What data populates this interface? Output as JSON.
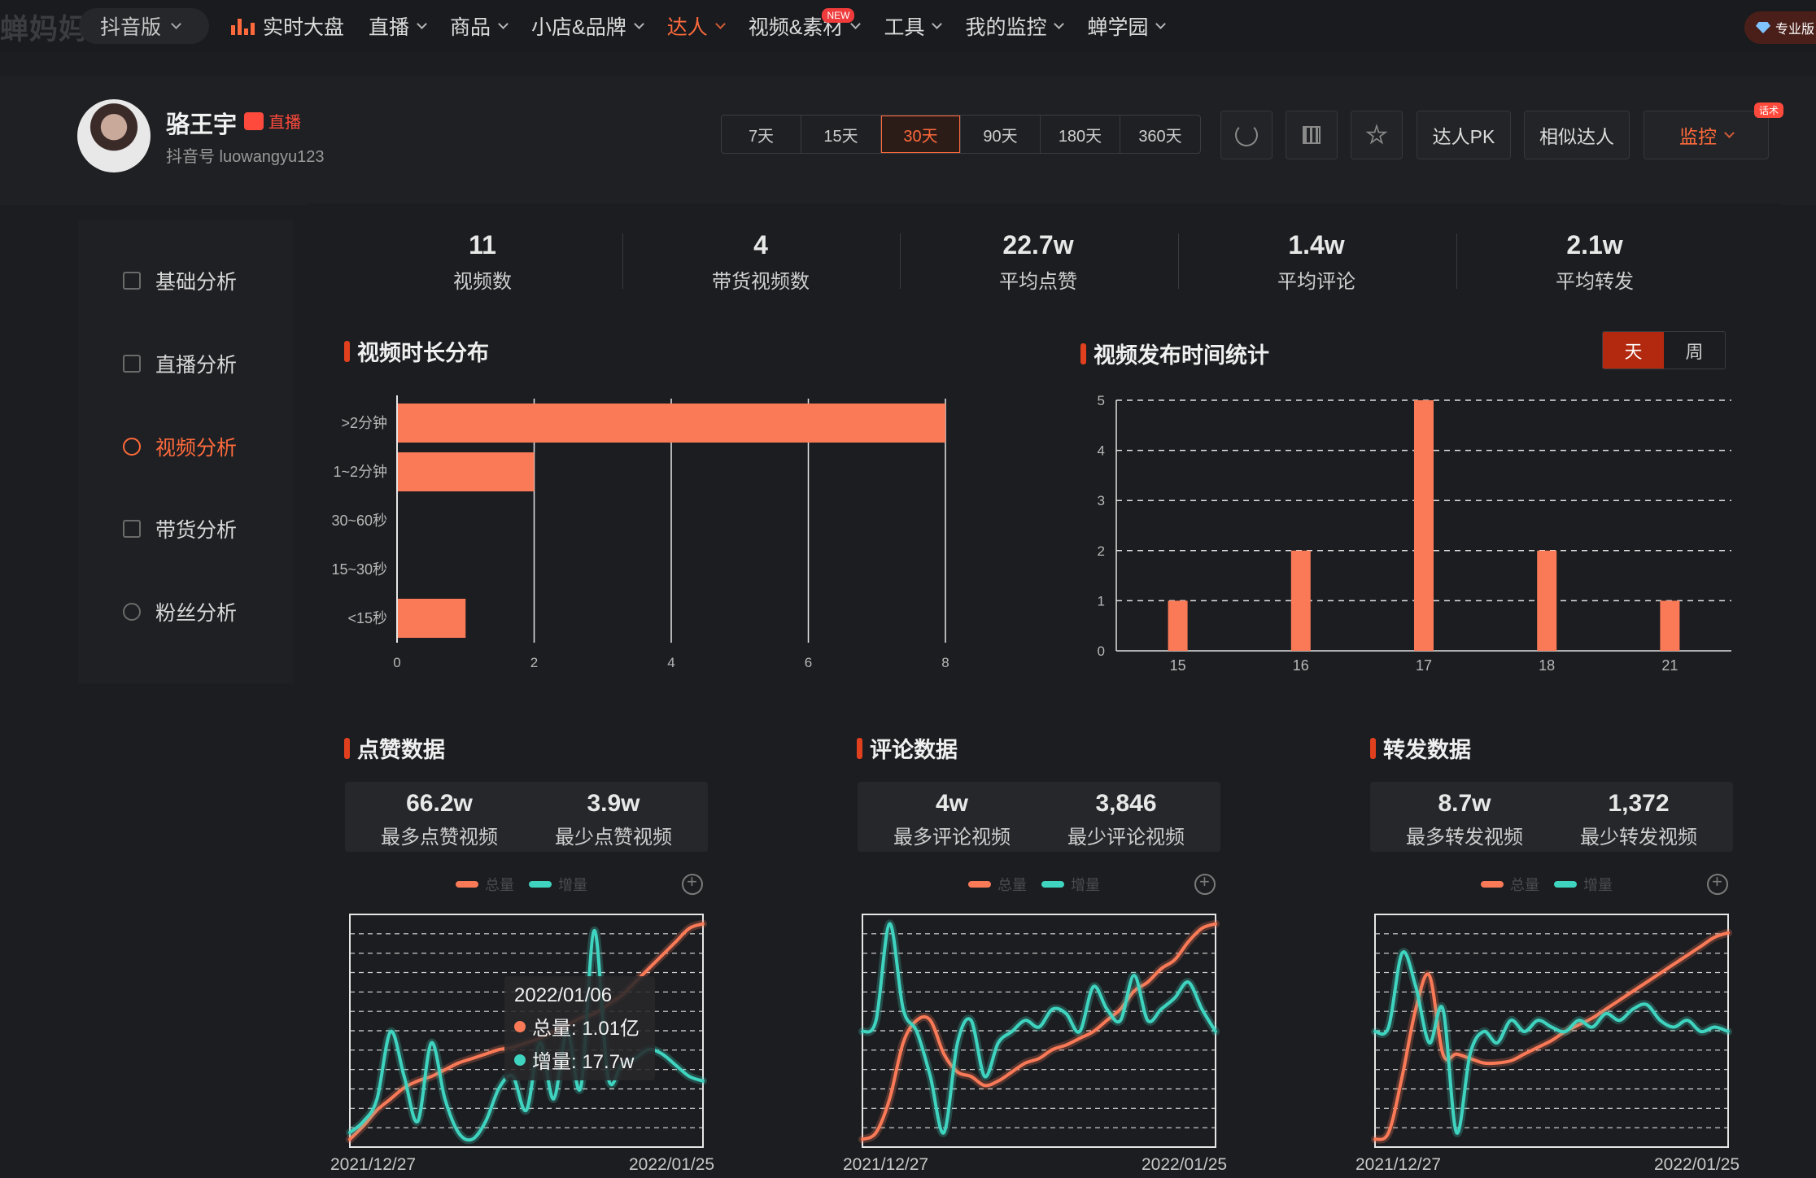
{
  "app": {
    "logo_text": "蝉妈妈",
    "version_label": "抖音版",
    "pro_label": "专业版"
  },
  "nav": {
    "items": [
      {
        "label": "实时大盘",
        "icon": "bar-chart-icon"
      },
      {
        "label": "直播"
      },
      {
        "label": "商品"
      },
      {
        "label": "小店&品牌"
      },
      {
        "label": "达人",
        "active": true
      },
      {
        "label": "视频&素材",
        "badge": "NEW"
      },
      {
        "label": "工具"
      },
      {
        "label": "我的监控"
      },
      {
        "label": "蝉学园"
      }
    ]
  },
  "profile": {
    "name": "骆王宇",
    "live_label": "直播",
    "douyin_id": "抖音号 luowangyu123"
  },
  "periods": [
    "7天",
    "15天",
    "30天",
    "90天",
    "180天",
    "360天"
  ],
  "active_period": "30天",
  "actions": {
    "pk": "达人PK",
    "similar": "相似达人",
    "monitor": "监控",
    "monitor_tag": "话术"
  },
  "sidebar": {
    "items": [
      {
        "label": "基础分析"
      },
      {
        "label": "直播分析"
      },
      {
        "label": "视频分析",
        "active": true
      },
      {
        "label": "带货分析"
      },
      {
        "label": "粉丝分析"
      }
    ]
  },
  "stats": [
    {
      "value": "11",
      "label": "视频数"
    },
    {
      "value": "4",
      "label": "带货视频数"
    },
    {
      "value": "22.7w",
      "label": "平均点赞"
    },
    {
      "value": "1.4w",
      "label": "平均评论"
    },
    {
      "value": "2.1w",
      "label": "平均转发"
    }
  ],
  "sections": {
    "duration": "视频时长分布",
    "publish": "视频发布时间统计",
    "publish_toggle": [
      "天",
      "周"
    ],
    "likes": "点赞数据",
    "comments": "评论数据",
    "shares": "转发数据"
  },
  "mini": {
    "likes": [
      {
        "value": "66.2w",
        "label": "最多点赞视频"
      },
      {
        "value": "3.9w",
        "label": "最少点赞视频"
      }
    ],
    "comments": [
      {
        "value": "4w",
        "label": "最多评论视频"
      },
      {
        "value": "3,846",
        "label": "最少评论视频"
      }
    ],
    "shares": [
      {
        "value": "8.7w",
        "label": "最多转发视频"
      },
      {
        "value": "1,372",
        "label": "最少转发视频"
      }
    ]
  },
  "legend": {
    "total": "总量",
    "increment": "增量"
  },
  "dates": {
    "start": "2021/12/27",
    "end": "2022/01/25"
  },
  "tooltip": {
    "date": "2022/01/06",
    "total": "总量: 1.01亿",
    "increment": "增量: 17.7w"
  },
  "colors": {
    "accent": "#fe6a3c",
    "bar": "#fa7a57",
    "teal": "#3fd4c0",
    "bg": "#1c1d20"
  },
  "chart_data": [
    {
      "type": "bar",
      "orientation": "horizontal",
      "categories": [
        ">2分钟",
        "1~2分钟",
        "30~60秒",
        "15~30秒",
        "<15秒"
      ],
      "values": [
        8,
        2,
        0,
        0,
        1
      ],
      "xlim": [
        0,
        8
      ],
      "xticks": [
        0,
        2,
        4,
        6,
        8
      ],
      "title": "视频时长分布"
    },
    {
      "type": "bar",
      "categories": [
        "15",
        "16",
        "17",
        "18",
        "21"
      ],
      "values": [
        1,
        2,
        5,
        2,
        1
      ],
      "ylim": [
        0,
        5
      ],
      "yticks": [
        0,
        1,
        2,
        3,
        4,
        5
      ],
      "title": "视频发布时间统计"
    },
    {
      "type": "line",
      "title": "点赞数据",
      "x_range": [
        "2021/12/27",
        "2022/01/25"
      ],
      "series": [
        {
          "name": "总量",
          "values": [
            0.02,
            0.08,
            0.15,
            0.2,
            0.25,
            0.28,
            0.3,
            0.33,
            0.36,
            0.38,
            0.4,
            0.42,
            0.43,
            0.45,
            0.47,
            0.5,
            0.53,
            0.56,
            0.58,
            0.62,
            0.66,
            0.72,
            0.78,
            0.84,
            0.9,
            0.96,
            0.98
          ]
        },
        {
          "name": "增量",
          "values": [
            0.05,
            0.1,
            0.2,
            0.5,
            0.3,
            0.1,
            0.45,
            0.2,
            0.05,
            0.02,
            0.1,
            0.25,
            0.3,
            0.15,
            0.45,
            0.2,
            0.5,
            0.25,
            0.95,
            0.3,
            0.35,
            0.38,
            0.42,
            0.4,
            0.35,
            0.3,
            0.28
          ]
        }
      ]
    },
    {
      "type": "line",
      "title": "评论数据",
      "x_range": [
        "2021/12/27",
        "2022/01/25"
      ],
      "series": [
        {
          "name": "总量",
          "values": [
            0.02,
            0.05,
            0.2,
            0.45,
            0.55,
            0.55,
            0.4,
            0.32,
            0.3,
            0.26,
            0.28,
            0.32,
            0.36,
            0.38,
            0.42,
            0.44,
            0.47,
            0.5,
            0.55,
            0.6,
            0.68,
            0.72,
            0.78,
            0.82,
            0.9,
            0.96,
            0.98
          ]
        },
        {
          "name": "增量",
          "values": [
            0.5,
            0.55,
            0.98,
            0.6,
            0.5,
            0.3,
            0.05,
            0.45,
            0.55,
            0.3,
            0.45,
            0.5,
            0.55,
            0.52,
            0.6,
            0.58,
            0.5,
            0.7,
            0.6,
            0.55,
            0.75,
            0.55,
            0.6,
            0.65,
            0.72,
            0.6,
            0.5
          ]
        }
      ]
    },
    {
      "type": "line",
      "title": "转发数据",
      "x_range": [
        "2021/12/27",
        "2022/01/25"
      ],
      "series": [
        {
          "name": "总量",
          "values": [
            0.02,
            0.05,
            0.3,
            0.6,
            0.75,
            0.4,
            0.4,
            0.38,
            0.36,
            0.36,
            0.37,
            0.4,
            0.43,
            0.46,
            0.5,
            0.53,
            0.56,
            0.6,
            0.64,
            0.68,
            0.72,
            0.76,
            0.8,
            0.84,
            0.88,
            0.92,
            0.94
          ]
        },
        {
          "name": "增量",
          "values": [
            0.5,
            0.52,
            0.85,
            0.7,
            0.45,
            0.6,
            0.05,
            0.4,
            0.5,
            0.45,
            0.55,
            0.5,
            0.55,
            0.52,
            0.5,
            0.55,
            0.52,
            0.58,
            0.55,
            0.6,
            0.62,
            0.55,
            0.52,
            0.55,
            0.5,
            0.52,
            0.5
          ]
        }
      ]
    }
  ]
}
